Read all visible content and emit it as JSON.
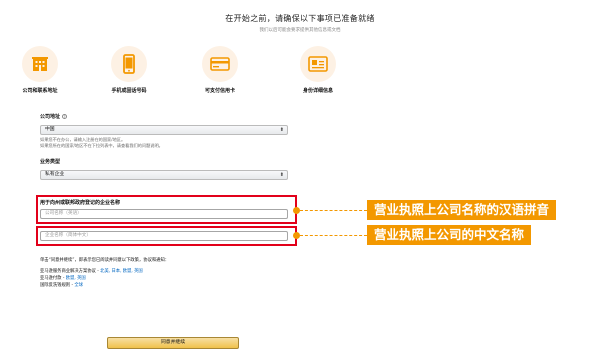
{
  "header": {
    "title": "在开始之前，请确保以下事项已准备就绪",
    "subtitle": "我们以后可能会要求提供其他信息或文档"
  },
  "steps": [
    {
      "label": "公司和联系地址",
      "icon": "building-icon"
    },
    {
      "label": "手机或固话号码",
      "icon": "mobile-phone-icon"
    },
    {
      "label": "可支付信用卡",
      "icon": "credit-card-icon"
    },
    {
      "label": "身份详细信息",
      "icon": "id-card-icon"
    }
  ],
  "form": {
    "country": {
      "label": "公司地址",
      "help_icon": "?",
      "value": "中国",
      "hint_lines": [
        "如果您不在办公，请输入注册在的国家/地区。",
        "如果您所在的国家/地区不在下拉列表中，请查看我们的问题说明。"
      ]
    },
    "business_type": {
      "label": "业务类型",
      "value": "私有企业"
    },
    "legal_name": {
      "label": "用于向州或联邦政府登记的企业名称",
      "pinyin_placeholder": "公司名称（英语）",
      "chinese_placeholder": "企业名称（简体中文）"
    },
    "notes": {
      "agreement_line": "单击“同意并继续”，即表示您已阅读并同意以下政策，协议和通知：",
      "service_prefix": "亚马逊服务商业解决方案协议 -",
      "service_links": "北美, 日本, 欧盟, 英国",
      "privacy_prefix": "亚马逊付款 -",
      "privacy_links": "欧盟, 英国",
      "intl_prefix": "国际反洗钱规则 -",
      "intl_links": "全球"
    },
    "submit_label": "同意并继续"
  },
  "callouts": {
    "pinyin": "营业执照上公司名称的汉语拼音",
    "chinese": "营业执照上公司的中文名称"
  },
  "colors": {
    "accent_orange": "#f39800",
    "highlight_red": "#e2001a",
    "link_blue": "#0066c0",
    "button_yellow": "#f0c14b"
  }
}
